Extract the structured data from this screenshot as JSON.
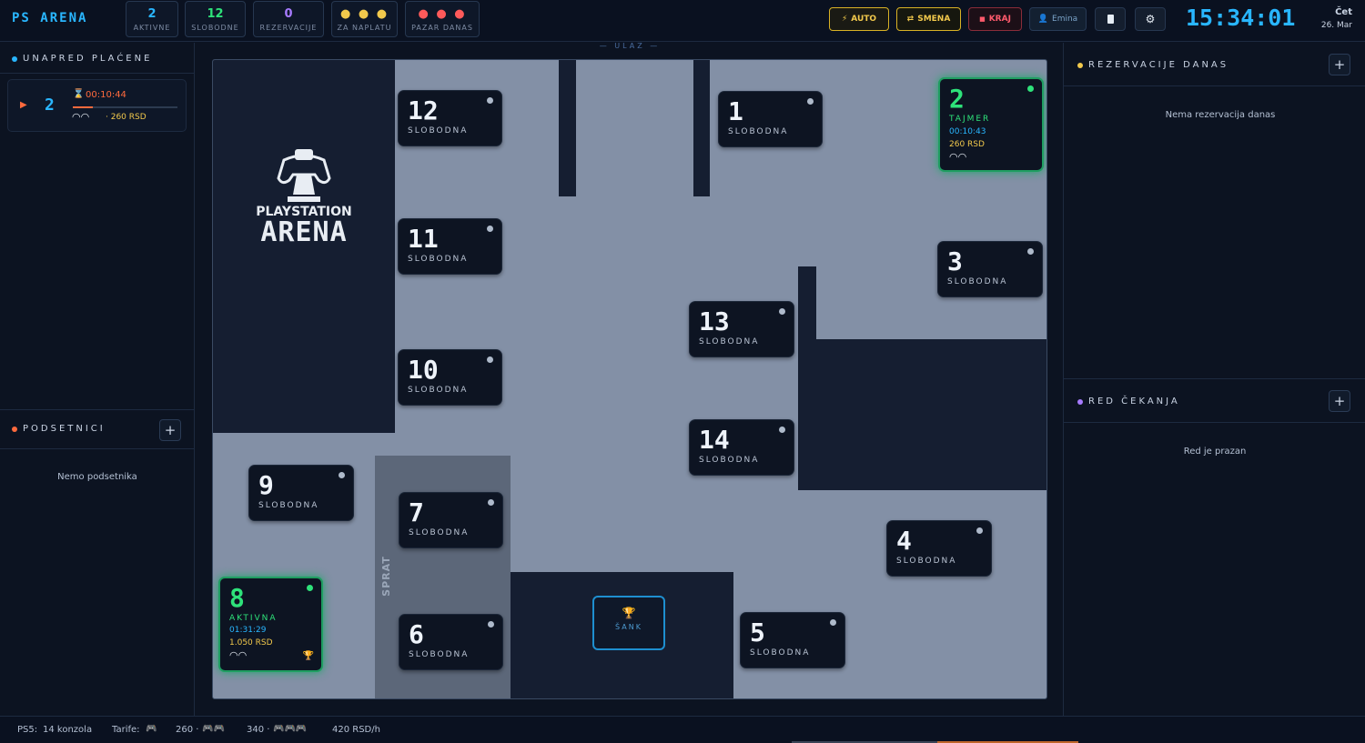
{
  "header": {
    "logo": "PS ARENA",
    "stats": [
      {
        "value": "2",
        "label": "AKTIVNE",
        "color": "#29b6ff"
      },
      {
        "value": "12",
        "label": "SLOBODNE",
        "color": "#2ee27a"
      },
      {
        "value": "0",
        "label": "REZERVACIJE",
        "color": "#a77bff"
      },
      {
        "value": "● ● ●",
        "label": "ZA NAPLATU",
        "color": "#f2c94c"
      },
      {
        "value": "● ● ●",
        "label": "PAZAR DANAS",
        "color": "#ff5a5a"
      }
    ],
    "auto": "AUTO",
    "smena": "SMENA",
    "kraj": "KRAJ",
    "user": "Emina",
    "clock": "15:34:01",
    "day": "Čet",
    "date": "26. Mar"
  },
  "left": {
    "prepaid_title": "UNAPRED PLAĆENE",
    "prepaid": {
      "station": "2",
      "time": "00:10:44",
      "price": "· 260 RSD"
    },
    "reminders_title": "PODSETNICI",
    "reminders_empty": "Nemo podsetnika"
  },
  "right": {
    "res_title": "REZERVACIJE DANAS",
    "res_empty": "Nema rezervacija danas",
    "queue_title": "RED ČEKANJA",
    "queue_empty": "Red je prazan"
  },
  "floor": {
    "entrance": "ULAZ",
    "brand_top": "PLAYSTATION",
    "brand_bottom": "ARENA",
    "stairs": "SPRAT",
    "bar": "ŠANK",
    "stations": {
      "s12": {
        "num": "12",
        "status": "SLOBODNA"
      },
      "s11": {
        "num": "11",
        "status": "SLOBODNA"
      },
      "s10": {
        "num": "10",
        "status": "SLOBODNA"
      },
      "s1": {
        "num": "1",
        "status": "SLOBODNA"
      },
      "s13": {
        "num": "13",
        "status": "SLOBODNA"
      },
      "s14": {
        "num": "14",
        "status": "SLOBODNA"
      },
      "s3": {
        "num": "3",
        "status": "SLOBODNA"
      },
      "s4": {
        "num": "4",
        "status": "SLOBODNA"
      },
      "s5": {
        "num": "5",
        "status": "SLOBODNA"
      },
      "s6": {
        "num": "6",
        "status": "SLOBODNA"
      },
      "s7": {
        "num": "7",
        "status": "SLOBODNA"
      },
      "s9": {
        "num": "9",
        "status": "SLOBODNA"
      },
      "s2": {
        "num": "2",
        "status": "TAJMER",
        "time": "00:10:43",
        "price": "260 RSD"
      },
      "s8": {
        "num": "8",
        "status": "AKTIVNA",
        "time": "01:31:29",
        "price": "1.050 RSD"
      }
    }
  },
  "footer": {
    "ps5": "PS5:",
    "consoles": "14 konzola",
    "tarife": "Tarife:",
    "rate1": "260 ·",
    "rate2": "340 ·",
    "rate3": "420 RSD/h"
  }
}
